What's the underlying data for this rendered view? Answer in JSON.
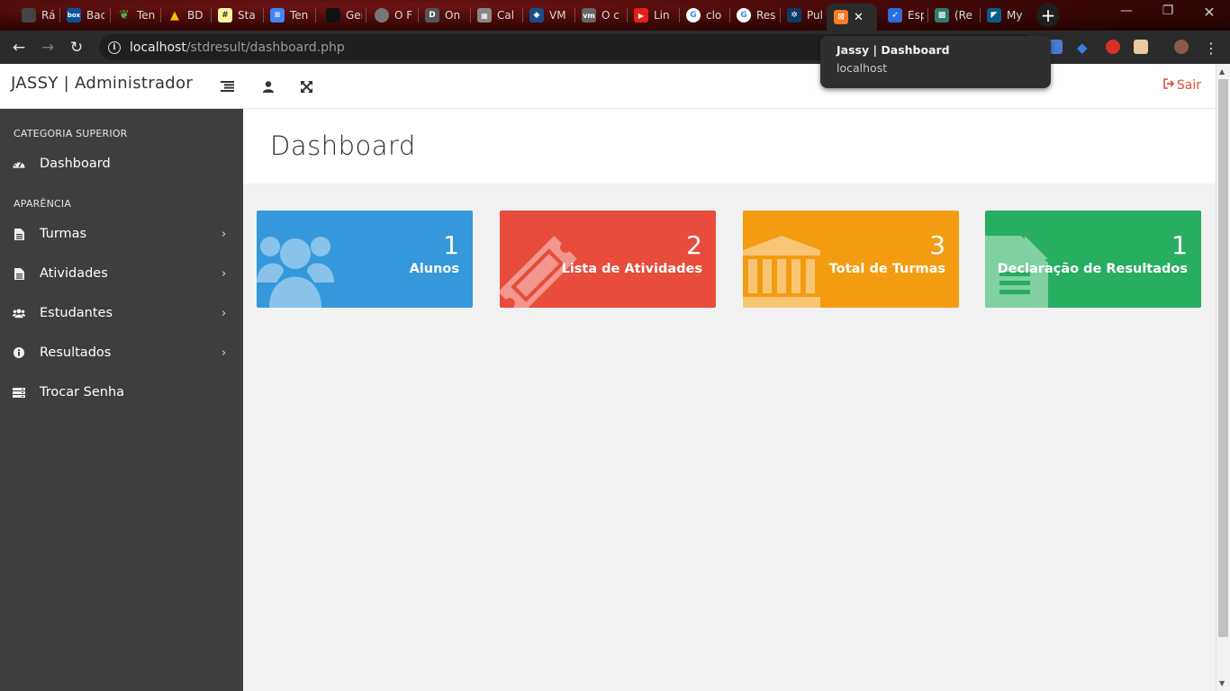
{
  "browser": {
    "tabs": [
      {
        "title": "Rác",
        "favicon_color": "#444444"
      },
      {
        "title": "Bac",
        "favicon_color": "#0b5394"
      },
      {
        "title": "Ten",
        "favicon_color": "#3c9a3c"
      },
      {
        "title": "BD",
        "favicon_color": "#1e88e5"
      },
      {
        "title": "Sta",
        "favicon_color": "#ffeb3b"
      },
      {
        "title": "Ten",
        "favicon_color": "#4285f4"
      },
      {
        "title": "Ger",
        "favicon_color": "#222222"
      },
      {
        "title": "O F",
        "favicon_color": "#777777"
      },
      {
        "title": "On",
        "favicon_color": "#555555"
      },
      {
        "title": "Cal",
        "favicon_color": "#888888"
      },
      {
        "title": "VM",
        "favicon_color": "#1a4e8a"
      },
      {
        "title": "O c",
        "favicon_color": "#666666"
      },
      {
        "title": "Lin",
        "favicon_color": "#e62117"
      },
      {
        "title": "clo",
        "favicon_color": "#888888"
      },
      {
        "title": "Res",
        "favicon_color": "#888888"
      },
      {
        "title": "Pul",
        "favicon_color": "#0d3b66"
      }
    ],
    "active_tab": {
      "title": "Jassy | Dashboard",
      "favicon_color": "#fb7a24",
      "close": "✕"
    },
    "tabs_right": [
      {
        "title": "Esp",
        "favicon_color": "#2d6cdf"
      },
      {
        "title": "(Re",
        "favicon_color": "#2e7d6b"
      },
      {
        "title": "My",
        "favicon_color": "#0b5a8a"
      }
    ],
    "url_host": "localhost",
    "url_path": "/stdresult/dashboard.php",
    "tooltip_title": "Jassy | Dashboard",
    "tooltip_host": "localhost",
    "new_tab": "+",
    "window_minimize": "—",
    "window_restore": "❐",
    "window_close": "✕"
  },
  "header": {
    "brand": "JASSY | Administrador",
    "logout_label": "Sair",
    "logout_color": "#e74c3c"
  },
  "sidebar": {
    "category_top": "CATEGORIA SUPERIOR",
    "category_look": "APARÊNCIA",
    "items": [
      {
        "label": "Dashboard",
        "icon": "dashboard-icon",
        "has_submenu": false
      },
      {
        "label": "Turmas",
        "icon": "file-icon",
        "has_submenu": true
      },
      {
        "label": "Atividades",
        "icon": "file-icon",
        "has_submenu": true
      },
      {
        "label": "Estudantes",
        "icon": "users-icon",
        "has_submenu": true
      },
      {
        "label": "Resultados",
        "icon": "info-icon",
        "has_submenu": true
      },
      {
        "label": "Trocar Senha",
        "icon": "server-icon",
        "has_submenu": false
      }
    ]
  },
  "main": {
    "page_title": "Dashboard",
    "cards": [
      {
        "count": "1",
        "label": "Alunos",
        "color": "#3498db",
        "icon": "users-icon"
      },
      {
        "count": "2",
        "label": "Lista de Atividades",
        "color": "#e74c3c",
        "icon": "ticket-icon"
      },
      {
        "count": "3",
        "label": "Total de Turmas",
        "color": "#f39c12",
        "icon": "bank-icon"
      },
      {
        "count": "1",
        "label": "Declaração de Resultados",
        "color": "#27ae60",
        "icon": "file-text-icon"
      }
    ]
  }
}
